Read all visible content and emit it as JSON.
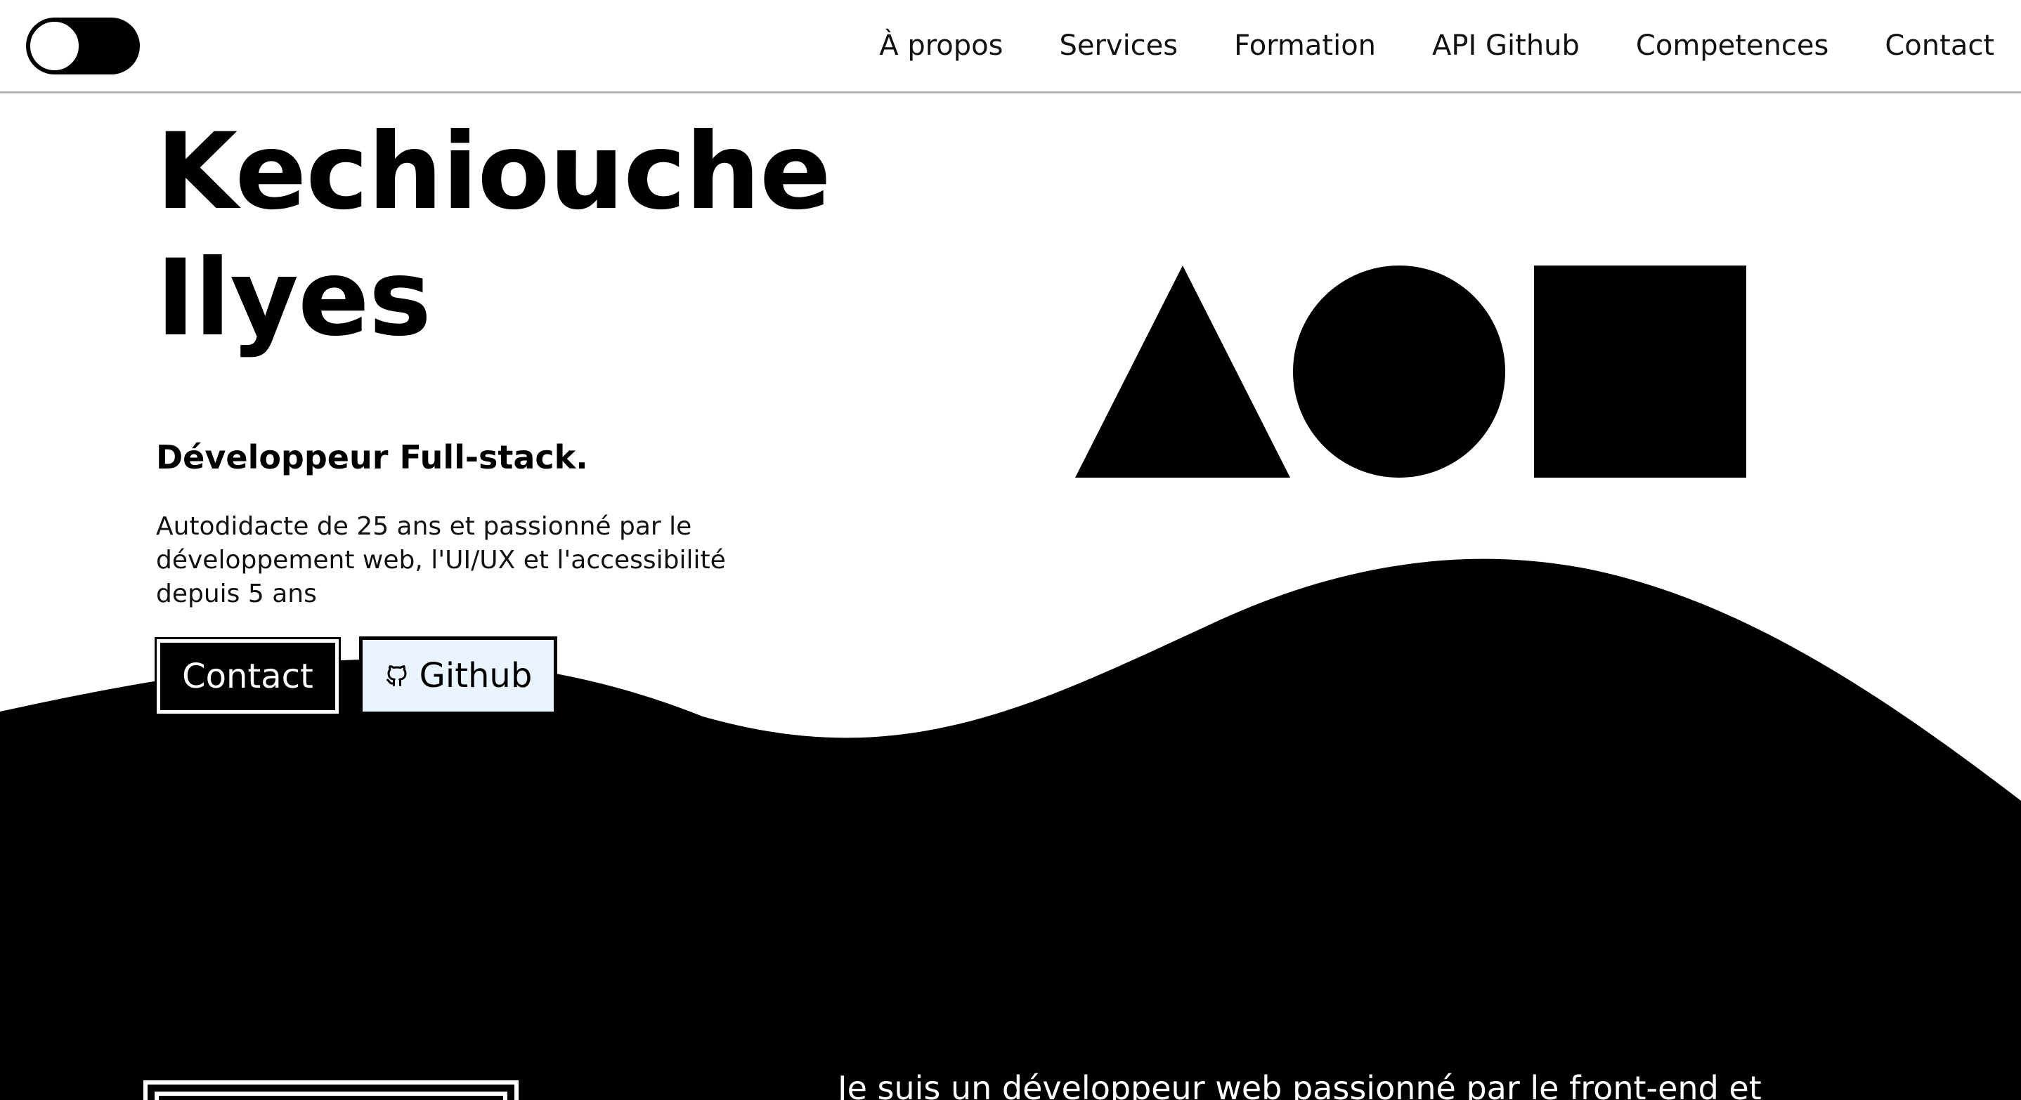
{
  "nav": {
    "theme_toggle": "theme-toggle",
    "links": [
      {
        "label": "À propos"
      },
      {
        "label": "Services"
      },
      {
        "label": "Formation"
      },
      {
        "label": "API Github"
      },
      {
        "label": "Competences"
      },
      {
        "label": "Contact"
      }
    ]
  },
  "hero": {
    "name_line1": "Kechiouche",
    "name_line2": "Ilyes",
    "role": "Développeur Full-stack.",
    "bio": "Autodidacte de 25 ans et passionné par le développement web, l'UI/UX et l'accessibilité depuis 5 ans",
    "buttons": {
      "contact_label": "Contact",
      "github_label": "Github",
      "github_icon": "github-icon"
    },
    "shapes": [
      "triangle",
      "circle",
      "square"
    ]
  },
  "about": {
    "intro": "Je suis un développeur web passionné par le front-end et"
  },
  "colors": {
    "background": "#ffffff",
    "foreground": "#000000",
    "github_button_bg": "#eaf4ff",
    "navbar_border": "#b3b3b3"
  }
}
